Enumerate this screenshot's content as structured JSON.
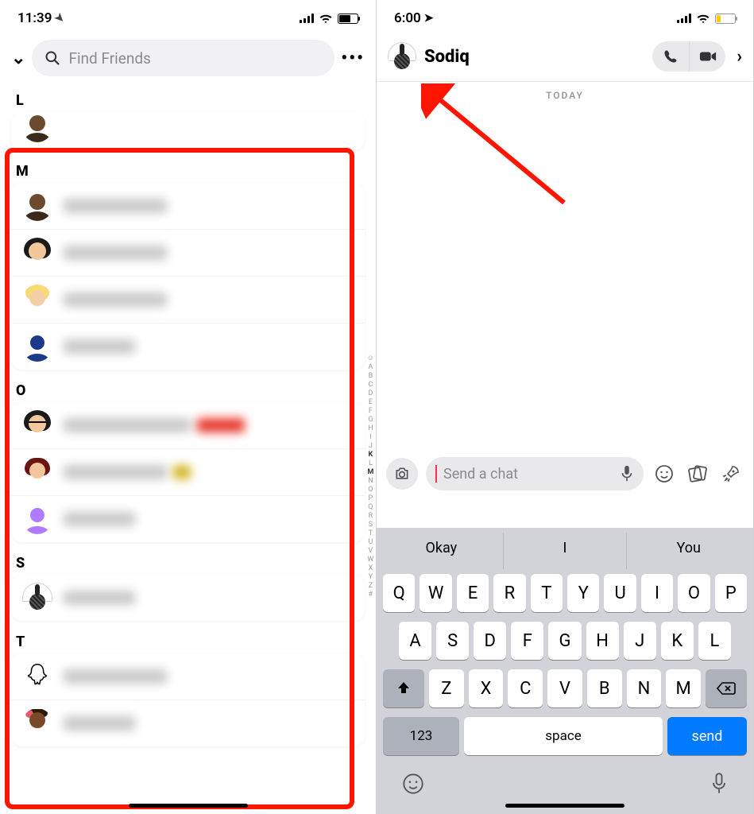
{
  "left": {
    "status_time": "11:39",
    "search_placeholder": "Find Friends",
    "sections": {
      "L": "L",
      "M": "M",
      "O": "O",
      "S": "S",
      "T": "T"
    },
    "alpha_index": [
      "☺",
      "A",
      "B",
      "C",
      "D",
      "E",
      "F",
      "G",
      "H",
      "I",
      "J",
      "K",
      "L",
      "M",
      "N",
      "O",
      "P",
      "Q",
      "R",
      "S",
      "T",
      "U",
      "V",
      "W",
      "X",
      "Y",
      "Z",
      "#"
    ]
  },
  "right": {
    "status_time": "6:00",
    "contact_name": "Sodiq",
    "today_label": "TODAY",
    "chat_placeholder": "Send a chat",
    "suggestions": [
      "Okay",
      "I",
      "You"
    ],
    "keyboard": {
      "row1": [
        "Q",
        "W",
        "E",
        "R",
        "T",
        "Y",
        "U",
        "I",
        "O",
        "P"
      ],
      "row2": [
        "A",
        "S",
        "D",
        "F",
        "G",
        "H",
        "J",
        "K",
        "L"
      ],
      "row3": [
        "Z",
        "X",
        "C",
        "V",
        "B",
        "N",
        "M"
      ],
      "num": "123",
      "space": "space",
      "send": "send"
    }
  }
}
